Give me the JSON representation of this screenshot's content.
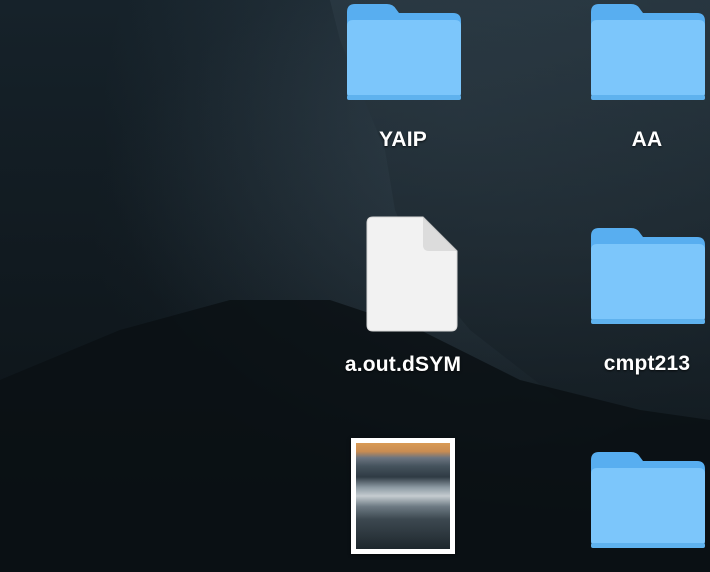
{
  "desktop": {
    "icons": [
      {
        "label": "YAIP",
        "kind": "folder-icon"
      },
      {
        "label": "AA",
        "kind": "folder-icon"
      },
      {
        "label": "a.out.dSYM",
        "kind": "document-icon"
      },
      {
        "label": "cmpt213",
        "kind": "folder-icon"
      },
      {
        "label": "",
        "kind": "image-thumbnail"
      },
      {
        "label": "",
        "kind": "folder-icon"
      }
    ]
  },
  "colors": {
    "folder_back": "#58aef0",
    "folder_front": "#7cc6fb",
    "label_text": "#ffffff"
  }
}
